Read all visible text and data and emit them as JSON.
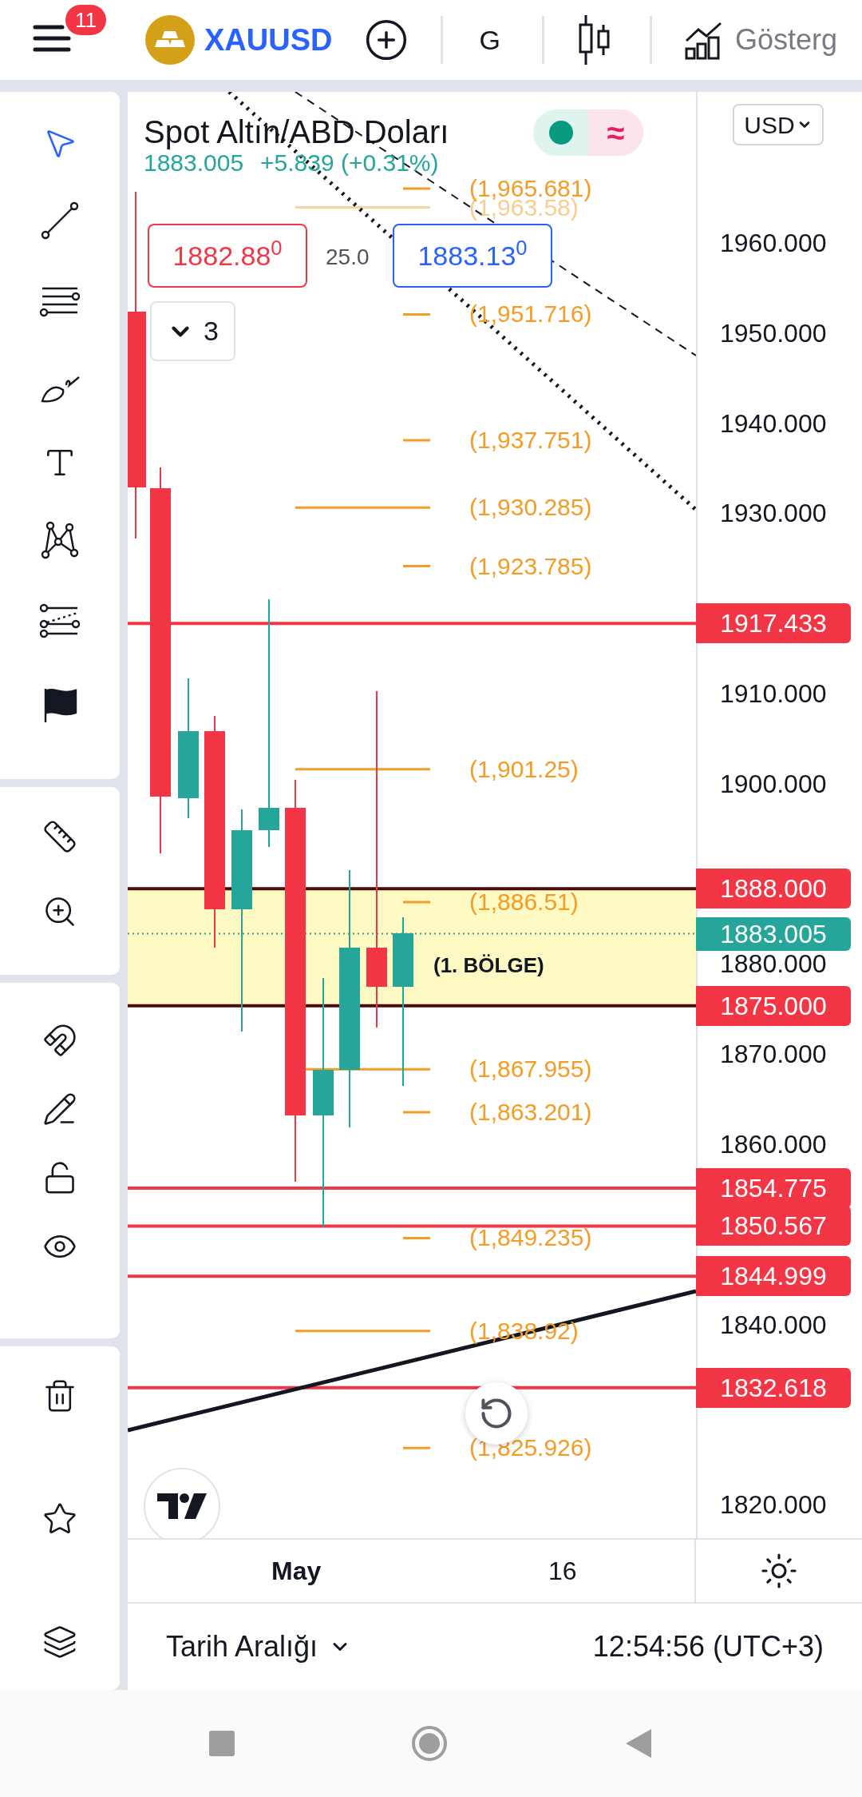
{
  "top_bar": {
    "notifications": "11",
    "symbol": "XAUUSD",
    "interval": "G",
    "indicators_label": "Gösterg"
  },
  "toolbar": {
    "groups": [
      [
        {
          "selected": true
        },
        {
          "selected": false
        },
        {
          "selected": false
        },
        {
          "selected": false
        },
        {
          "selected": false
        },
        {
          "selected": false
        },
        {
          "selected": false
        },
        {
          "selected": false
        }
      ],
      [
        {
          "selected": false
        },
        {
          "selected": false
        }
      ],
      [
        {
          "selected": false
        },
        {
          "selected": false
        },
        {
          "selected": false
        },
        {
          "selected": false
        }
      ],
      [
        {
          "selected": false
        },
        {
          "selected": false
        },
        {
          "selected": false
        }
      ]
    ]
  },
  "legend": {
    "title": "Spot Altın/ABD Doları",
    "status_symbol": "≈",
    "price": "1883.005",
    "change": "+5.839 (+0.31%)"
  },
  "trade": {
    "sell": "1882.88$^{0}$",
    "spread": "25.0",
    "buy": "1883.13$^{0}$",
    "collapse_count": "3"
  },
  "fib_levels": [
    {
      "label": "(1,965.681)",
      "kind": "short",
      "faded": false
    },
    {
      "label": "(1,963.58)",
      "kind": "long",
      "faded": true
    },
    {
      "label": "(1,951.716)",
      "kind": "short",
      "faded": false
    },
    {
      "label": "(1,937.751)",
      "kind": "short",
      "faded": false
    },
    {
      "label": "(1,930.285)",
      "kind": "long",
      "faded": false
    },
    {
      "label": "(1,923.785)",
      "kind": "short",
      "faded": false
    },
    {
      "label": "(1,901.25)",
      "kind": "long",
      "faded": false
    },
    {
      "label": "(1,886.51)",
      "kind": "short",
      "faded": false
    },
    {
      "label": "(1,867.955)",
      "kind": "long",
      "faded": false
    },
    {
      "label": "(1,863.201)",
      "kind": "short",
      "faded": false
    },
    {
      "label": "(1,849.235)",
      "kind": "short",
      "faded": false
    },
    {
      "label": "(1,838.92)",
      "kind": "long",
      "faded": false
    },
    {
      "label": "(1,825.926)",
      "kind": "short",
      "faded": false
    }
  ],
  "zone": {
    "label": "(1. BÖLGE)"
  },
  "price_axis": {
    "currency": "USD",
    "ticks": [
      "1960.000",
      "1950.000",
      "1940.000",
      "1930.000",
      "1910.000",
      "1900.000",
      "1880.000",
      "1870.000",
      "1860.000",
      "1840.000",
      "1820.000"
    ]
  },
  "price_lines": [
    {
      "label": "1917.433",
      "kind": "line"
    },
    {
      "label": "1888.000",
      "kind": "zone_edge"
    },
    {
      "label": "1875.000",
      "kind": "zone_edge"
    },
    {
      "label": "1854.775",
      "kind": "line"
    },
    {
      "label": "1850.567",
      "kind": "line"
    },
    {
      "label": "1844.999",
      "kind": "line"
    },
    {
      "label": "1832.618",
      "kind": "line"
    }
  ],
  "last_price": "1883.005",
  "time_axis": [
    {
      "text": "May",
      "bold": true
    },
    {
      "text": "16",
      "bold": false
    }
  ],
  "bottom_bar": {
    "range_label": "Tarih Aralığı",
    "clock": "12:54:56 (UTC+3)"
  }
}
